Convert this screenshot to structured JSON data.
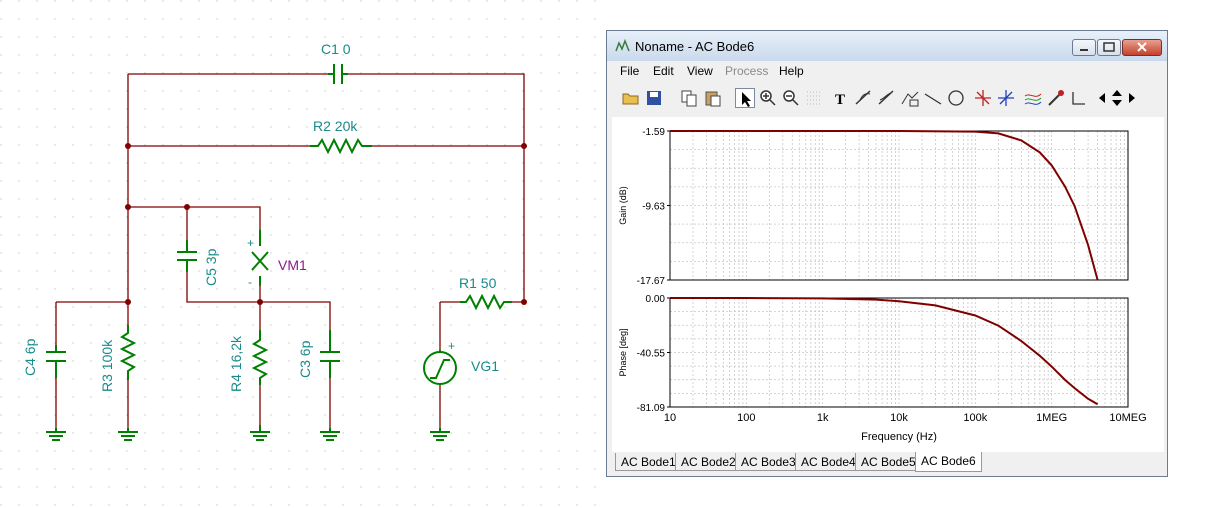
{
  "schematic": {
    "components": {
      "c1": "C1 0",
      "r2": "R2 20k",
      "c5": "C5 3p",
      "vm1": "VM1",
      "r1": "R1 50",
      "c4": "C4 6p",
      "r3": "R3 100k",
      "r4": "R4 16,2k",
      "c3": "C3 6p",
      "vg1": "VG1"
    },
    "plus_sign": "+",
    "minus_sign": "-",
    "colors": {
      "wire": "#800000",
      "component": "#008000",
      "label_teal": "#1a8a8a",
      "label_purple": "#8a1a8a",
      "node": "#800000"
    }
  },
  "window": {
    "title": "Noname - AC Bode6",
    "menu": [
      "File",
      "Edit",
      "View",
      "Process",
      "Help"
    ],
    "menu_disabled": "Process",
    "toolbar_icons": [
      "open-icon",
      "save-icon",
      "copy-icon",
      "paste-icon",
      "pointer-icon",
      "zoom-in-icon",
      "zoom-out-icon",
      "grid-icon",
      "text-icon",
      "cursor-a-icon",
      "cursor-b-icon",
      "curve-icon",
      "line-icon",
      "circle-icon",
      "marker-a-icon",
      "marker-b-icon",
      "series-icon",
      "probe-icon",
      "corner-icon",
      "left-icon",
      "up-down-icon",
      "right-icon"
    ],
    "tabs": [
      "AC Bode1",
      "AC Bode2",
      "AC Bode3",
      "AC Bode4",
      "AC Bode5",
      "AC Bode6"
    ],
    "active_tab": "AC Bode6"
  },
  "chart_data": [
    {
      "type": "line",
      "ylabel": "Gain (dB)",
      "xscale": "log",
      "xlim": [
        10,
        10000000
      ],
      "ylim": [
        -17.67,
        -1.59
      ],
      "yticks": [
        "-1.59",
        "-9.63",
        "-17.67"
      ],
      "series": [
        {
          "color": "#800000",
          "x": [
            10,
            100,
            1000,
            10000,
            100000,
            200000,
            400000,
            700000,
            1000000,
            1500000,
            2000000,
            3000000,
            4000000
          ],
          "y": [
            -1.59,
            -1.59,
            -1.59,
            -1.59,
            -1.66,
            -1.85,
            -2.6,
            -3.9,
            -5.3,
            -7.6,
            -9.7,
            -13.9,
            -17.67
          ]
        }
      ]
    },
    {
      "type": "line",
      "ylabel": "Phase [deg]",
      "xlabel": "Frequency (Hz)",
      "xscale": "log",
      "xlim": [
        10,
        10000000
      ],
      "ylim": [
        -81.09,
        0.0
      ],
      "yticks": [
        "0.00",
        "-40.55",
        "-81.09"
      ],
      "xticks": [
        "10",
        "100",
        "1k",
        "10k",
        "100k",
        "1MEG",
        "10MEG"
      ],
      "series": [
        {
          "color": "#800000",
          "x": [
            10,
            100,
            1000,
            5000,
            10000,
            30000,
            100000,
            200000,
            400000,
            700000,
            1000000,
            1500000,
            2000000,
            3000000,
            4000000
          ],
          "y": [
            0,
            0,
            -0.3,
            -1.2,
            -2.4,
            -5.5,
            -13,
            -20.5,
            -32,
            -43,
            -51,
            -61,
            -67,
            -75,
            -79
          ]
        }
      ]
    }
  ]
}
